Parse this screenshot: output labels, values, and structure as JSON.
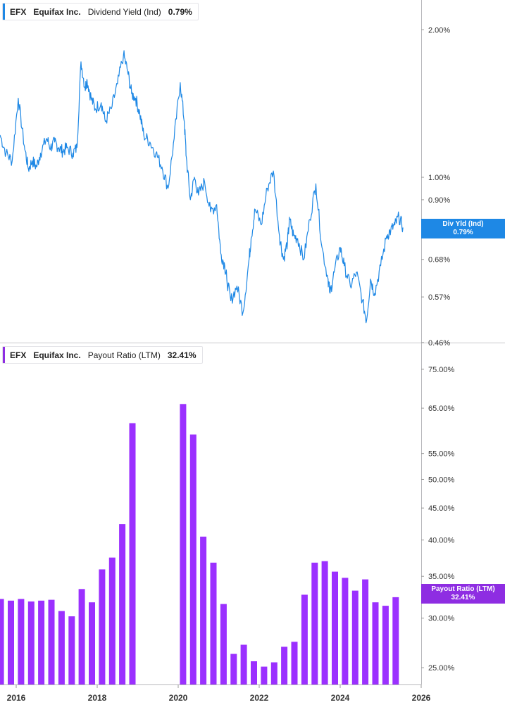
{
  "top_legend": {
    "ticker": "EFX",
    "company": "Equifax Inc.",
    "metric": "Dividend Yield (Ind)",
    "value": "0.79%",
    "color": "#1e88e5"
  },
  "bottom_legend": {
    "ticker": "EFX",
    "company": "Equifax Inc.",
    "metric": "Payout Ratio (LTM)",
    "value": "32.41%",
    "color": "#8e2de2"
  },
  "top_flag": {
    "line1": "Div Yld (Ind)",
    "line2": "0.79%"
  },
  "bottom_flag": {
    "line1": "Payout Ratio (LTM)",
    "line2": "32.41%"
  },
  "chart_data": [
    {
      "type": "line",
      "title": "EFX Equifax Inc. Dividend Yield (Ind)",
      "scale": "log",
      "ylim": [
        0.46,
        2.3
      ],
      "y_ticks": [
        "2.00%",
        "1.00%",
        "0.90%",
        "0.79%",
        "0.68%",
        "0.57%",
        "0.46%"
      ],
      "x": [
        2015.6,
        2015.75,
        2015.9,
        2016.05,
        2016.2,
        2016.3,
        2016.4,
        2016.5,
        2016.6,
        2016.75,
        2016.85,
        2016.95,
        2017.05,
        2017.15,
        2017.25,
        2017.4,
        2017.5,
        2017.6,
        2017.7,
        2017.75,
        2017.85,
        2017.95,
        2018.1,
        2018.2,
        2018.35,
        2018.5,
        2018.65,
        2018.75,
        2018.85,
        2018.95,
        2019.05,
        2019.15,
        2019.3,
        2019.45,
        2019.6,
        2019.75,
        2019.9,
        2020.05,
        2020.15,
        2020.2,
        2020.3,
        2020.4,
        2020.5,
        2020.65,
        2020.8,
        2020.95,
        2021.05,
        2021.15,
        2021.2,
        2021.3,
        2021.45,
        2021.6,
        2021.75,
        2021.8,
        2021.9,
        2022.05,
        2022.2,
        2022.35,
        2022.5,
        2022.6,
        2022.7,
        2022.75,
        2022.85,
        2022.95,
        2023.1,
        2023.25,
        2023.4,
        2023.55,
        2023.7,
        2023.75,
        2023.85,
        2024.0,
        2024.1,
        2024.25,
        2024.4,
        2024.55,
        2024.65,
        2024.75,
        2024.85,
        2025.0,
        2025.15,
        2025.25,
        2025.35,
        2025.45,
        2025.55
      ],
      "series": [
        {
          "values": [
            1.22,
            1.12,
            1.08,
            1.45,
            1.16,
            1.04,
            1.08,
            1.05,
            1.12,
            1.2,
            1.15,
            1.18,
            1.15,
            1.13,
            1.15,
            1.12,
            1.15,
            1.72,
            1.52,
            1.58,
            1.45,
            1.38,
            1.42,
            1.3,
            1.38,
            1.55,
            1.78,
            1.65,
            1.48,
            1.45,
            1.35,
            1.22,
            1.18,
            1.12,
            1.05,
            0.95,
            1.2,
            1.56,
            1.3,
            1.1,
            0.9,
            1.0,
            0.92,
            0.98,
            0.85,
            0.88,
            0.7,
            0.66,
            0.62,
            0.56,
            0.6,
            0.53,
            0.68,
            0.75,
            0.86,
            0.8,
            0.95,
            1.03,
            0.76,
            0.68,
            0.74,
            0.82,
            0.76,
            0.75,
            0.68,
            0.82,
            0.97,
            0.72,
            0.62,
            0.58,
            0.64,
            0.72,
            0.66,
            0.6,
            0.64,
            0.56,
            0.51,
            0.62,
            0.58,
            0.66,
            0.76,
            0.78,
            0.8,
            0.83,
            0.79
          ]
        }
      ]
    },
    {
      "type": "bar",
      "title": "EFX Equifax Inc. Payout Ratio (LTM)",
      "scale": "log",
      "ylim": [
        23.5,
        80
      ],
      "y_ticks": [
        "75.00%",
        "65.00%",
        "55.00%",
        "50.00%",
        "45.00%",
        "40.00%",
        "35.00%",
        "32.41%",
        "30.00%",
        "25.00%"
      ],
      "x_ticks": [
        "2016",
        "2018",
        "2020",
        "2022",
        "2024",
        "2026"
      ],
      "xlim": [
        2015.6,
        2026.0
      ],
      "x": [
        2015.62,
        2015.87,
        2016.12,
        2016.37,
        2016.62,
        2016.87,
        2017.12,
        2017.37,
        2017.62,
        2017.87,
        2018.12,
        2018.37,
        2018.62,
        2018.87,
        2020.12,
        2020.37,
        2020.62,
        2020.87,
        2021.12,
        2021.37,
        2021.62,
        2021.87,
        2022.12,
        2022.37,
        2022.62,
        2022.87,
        2023.12,
        2023.37,
        2023.62,
        2023.87,
        2024.12,
        2024.37,
        2024.62,
        2024.87,
        2025.12,
        2025.37
      ],
      "series": [
        {
          "values": [
            32.2,
            32.0,
            32.2,
            31.9,
            32.0,
            32.1,
            30.8,
            30.2,
            33.4,
            31.8,
            35.9,
            37.5,
            42.4,
            61.5,
            66.0,
            59.0,
            40.5,
            36.8,
            31.6,
            26.3,
            27.2,
            25.6,
            25.1,
            25.5,
            27.0,
            27.5,
            32.7,
            36.8,
            37.0,
            35.6,
            34.8,
            33.2,
            34.6,
            31.8,
            31.4,
            32.41
          ]
        }
      ]
    }
  ]
}
